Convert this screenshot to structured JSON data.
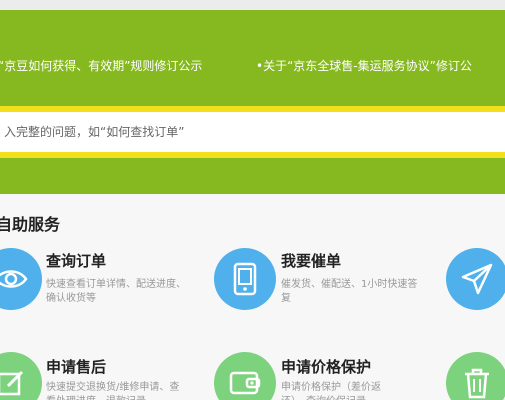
{
  "notices": [
    "“京豆如何获得、有效期”规则修订公示",
    "•关于“京东全球售-集运服务协议”修订公"
  ],
  "search": {
    "placeholder": "入完整的问题，如“如何查找订单”"
  },
  "section": {
    "title": "自助服务"
  },
  "services": {
    "query_order": {
      "title": "查询订单",
      "desc": "快速查看订单详情、配送进度、确认收货等",
      "icon": "eye-icon"
    },
    "urge_order": {
      "title": "我要催单",
      "desc": "催发货、催配送、1小时快速答复",
      "icon": "phone-icon"
    },
    "send": {
      "icon": "paper-plane-icon"
    },
    "after_sale": {
      "title": "申请售后",
      "desc": "快速提交退换货/维修申请、查看处理进度、退款记录",
      "icon": "edit-icon"
    },
    "price_protect": {
      "title": "申请价格保护",
      "desc": "申请价格保护（差价返还）、查询价保记录",
      "icon": "wallet-icon"
    },
    "trash": {
      "icon": "trash-icon"
    }
  },
  "colors": {
    "banner": "#86b81f",
    "search_border": "#f3e01c",
    "blue_icon": "#4fb0ec",
    "green_icon": "#7dd27d"
  }
}
